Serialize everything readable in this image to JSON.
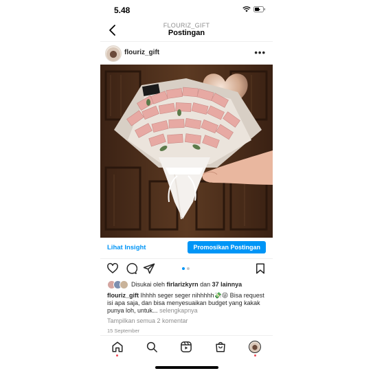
{
  "status": {
    "time": "5.48"
  },
  "header": {
    "account": "FLOURIZ_GIFT",
    "title": "Postingan"
  },
  "post": {
    "username": "flouriz_gift",
    "more_label": "•••",
    "photo_alt": "money bouquet"
  },
  "insight": {
    "view_label": "Lihat Insight",
    "promote_label": "Promosikan Postingan"
  },
  "carousel": {
    "count": 2,
    "active": 1
  },
  "likes": {
    "prefix": "Disukai oleh",
    "user": "firlarizkyrn",
    "joiner": "dan",
    "others": "37 lainnya"
  },
  "caption": {
    "username": "flouriz_gift",
    "text": "Ihhhh seger seger nihhhhh💸😜 Bisa request isi apa saja, dan bisa menyesuaikan budget yang kakak punya loh, untuk...",
    "more": "selengkapnya"
  },
  "comments_link": "Tampilkan semua 2 komentar",
  "date": "15 September",
  "colors": {
    "accent": "#0095f6",
    "notify": "#ed4956"
  },
  "tabbar": {
    "items": [
      {
        "icon": "home-icon"
      },
      {
        "icon": "search-icon"
      },
      {
        "icon": "reels-icon"
      },
      {
        "icon": "shop-icon"
      },
      {
        "icon": "profile-avatar"
      }
    ]
  }
}
